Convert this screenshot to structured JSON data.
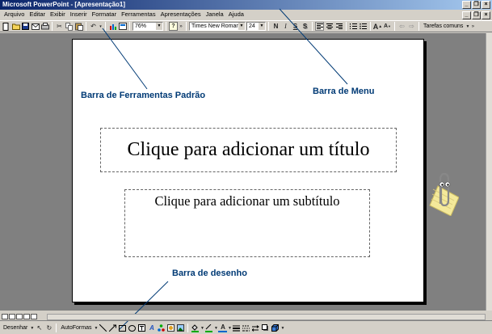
{
  "window": {
    "title": "Microsoft PowerPoint - [Apresentação1]"
  },
  "menu": {
    "items": [
      "Arquivo",
      "Editar",
      "Exibir",
      "Inserir",
      "Formatar",
      "Ferramentas",
      "Apresentações",
      "Janela",
      "Ajuda"
    ]
  },
  "toolbar": {
    "zoom": "76%",
    "font_name": "Times New Roman",
    "font_size": "24",
    "bold": "N",
    "italic": "I",
    "underline": "S",
    "shadow": "S",
    "tasks_label": "Tarefas comuns"
  },
  "slide": {
    "title_placeholder": "Clique para adicionar um título",
    "subtitle_placeholder": "Clique para adicionar um subtítulo"
  },
  "annotations": {
    "standard_toolbar": "Barra de Ferramentas Padrão",
    "menu_bar": "Barra de Menu",
    "drawing_bar": "Barra de desenho"
  },
  "drawbar": {
    "draw_label": "Desenhar",
    "autoshapes_label": "AutoFormas"
  },
  "colors": {
    "annotation_text": "#003a75",
    "titlebar_start": "#0a246a",
    "titlebar_end": "#a6caf0",
    "workspace": "#808080"
  }
}
